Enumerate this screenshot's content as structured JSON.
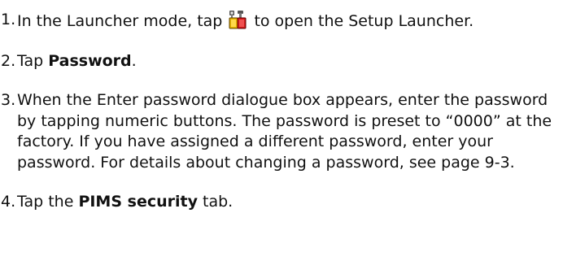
{
  "steps": [
    {
      "number": "1.",
      "before_icon": "In the Launcher mode, tap",
      "icon": "setup-tools-icon",
      "after_icon": "to open the Setup Launcher."
    },
    {
      "number": "2.",
      "before": "Tap ",
      "bold": "Password",
      "after": "."
    },
    {
      "number": "3.",
      "text": "When the Enter password dialogue box appears, enter the password by tapping numeric buttons. The password is preset to “0000” at the factory. If you have assigned a different password, enter your password. For details about changing a password, see page 9-3."
    },
    {
      "number": "4.",
      "before": "Tap the ",
      "bold": "PIMS security",
      "after": " tab."
    }
  ]
}
